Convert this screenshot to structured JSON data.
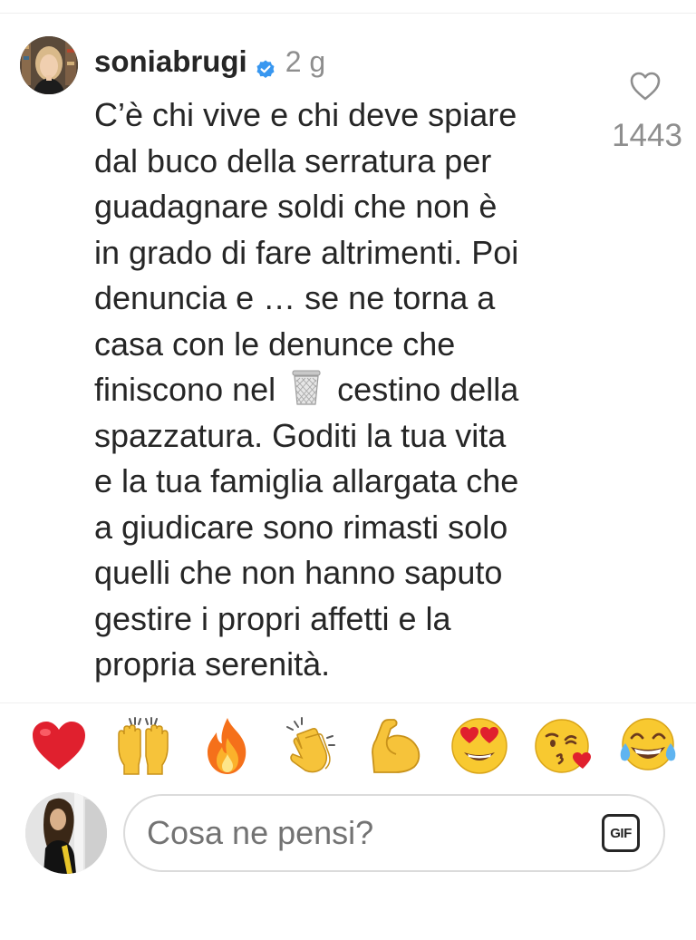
{
  "comment": {
    "username": "soniabrugi",
    "timestamp": "2 g",
    "lines": [
      "C’è chi vive e chi deve spiare",
      "dal buco della serratura per",
      "guadagnare soldi che non è",
      "in grado di fare altrimenti. Poi",
      "denuncia e … se ne torna a",
      "casa con le denunce che",
      "finiscono nel",
      "cestino della",
      "spazzatura.  Goditi la tua vita",
      "e la tua famiglia allargata che",
      "a giudicare sono rimasti solo",
      "quelli che non hanno saputo",
      "gestire i propri affetti e la",
      "propria serenità."
    ],
    "inline_icon": "wastebasket-icon",
    "like_count": "1443",
    "verified_icon": "verified-badge-icon",
    "like_icon": "heart-outline-icon"
  },
  "reactions": [
    {
      "name": "red-heart-emoji",
      "label": "red heart"
    },
    {
      "name": "raising-hands-emoji",
      "label": "raising hands"
    },
    {
      "name": "fire-emoji",
      "label": "fire"
    },
    {
      "name": "clapping-hands-emoji",
      "label": "clapping hands"
    },
    {
      "name": "flexed-biceps-emoji",
      "label": "flexed biceps"
    },
    {
      "name": "heart-eyes-emoji",
      "label": "smiling face with heart-eyes"
    },
    {
      "name": "face-blowing-kiss-emoji",
      "label": "face blowing a kiss"
    },
    {
      "name": "tears-of-joy-emoji",
      "label": "face with tears of joy"
    }
  ],
  "reply": {
    "placeholder": "Cosa ne pensi?",
    "gif_label": "GIF"
  },
  "colors": {
    "text": "#262626",
    "secondary": "#8e8e8e",
    "verified": "#3897f0",
    "divider": "#efefef",
    "input_border": "#dbdbdb"
  }
}
